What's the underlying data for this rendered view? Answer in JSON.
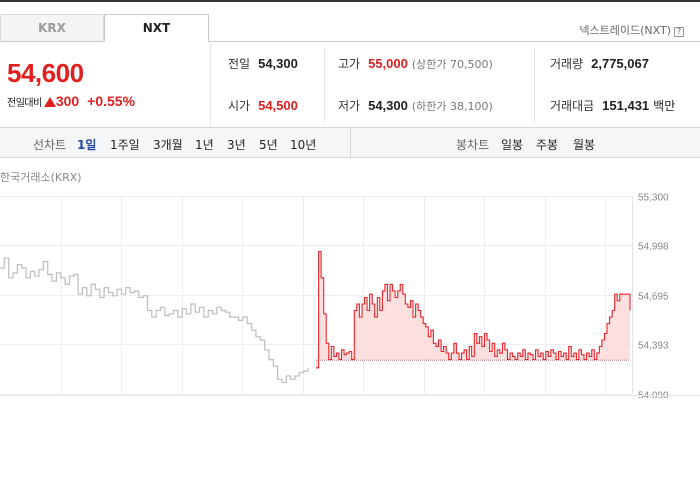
{
  "tabs": [
    {
      "label": "KRX",
      "active": false
    },
    {
      "label": "NXT",
      "active": true
    }
  ],
  "provider": {
    "label": "넥스트레이드(NXT)",
    "help_icon": "?"
  },
  "quote": {
    "price": "54,600",
    "change_label": "전일대비",
    "direction_icon": "up-triangle-icon",
    "change_value": "300",
    "change_percent": "+0.55%"
  },
  "stats": {
    "prev_close": {
      "label": "전일",
      "value": "54,300"
    },
    "high": {
      "label": "고가",
      "value": "55,000",
      "sub": "(상한가 70,500)"
    },
    "volume": {
      "label": "거래량",
      "value": "2,775,067"
    },
    "open": {
      "label": "시가",
      "value": "54,500"
    },
    "low": {
      "label": "저가",
      "value": "54,300",
      "sub": "(하한가 38,100)"
    },
    "turnover": {
      "label": "거래대금",
      "value": "151,431",
      "unit": "백만"
    }
  },
  "toolbar": {
    "line_label": "선차트",
    "line_periods": [
      "1일",
      "1주일",
      "3개월",
      "1년",
      "3년",
      "5년",
      "10년"
    ],
    "active_period": "1일",
    "candle_label": "봉차트",
    "candle_periods": [
      "일봉",
      "주봉",
      "월봉"
    ]
  },
  "chart_data": {
    "type": "line",
    "title": "한국거래소(KRX)",
    "y_ticks": [
      "55,300",
      "54,998",
      "54,695",
      "54,393",
      "54,090"
    ],
    "ylim": [
      54090,
      55300
    ],
    "baseline": 54300,
    "colors": {
      "krx": "#bdbdbd",
      "nxt": "#e8242a",
      "nxt_fill": "#fbd9d9",
      "grid": "#eeeeee"
    },
    "series": [
      {
        "values": [
          54860,
          54920,
          54800,
          54830,
          54880,
          54860,
          54800,
          54840,
          54810,
          54850,
          54900,
          54820,
          54780,
          54830,
          54800,
          54760,
          54810,
          54820,
          54700,
          54740,
          54690,
          54760,
          54730,
          54680,
          54740,
          54710,
          54690,
          54730,
          54700,
          54740,
          54710,
          54720,
          54680,
          54690,
          54600,
          54560,
          54600,
          54620,
          54570,
          54580,
          54600,
          54560,
          54610,
          54580,
          54640,
          54590,
          54620,
          54560,
          54600,
          54580,
          54620,
          54600,
          54590,
          54560,
          54560,
          54540,
          54560,
          54520,
          54480,
          54440,
          54420,
          54360,
          54300,
          54260,
          54180,
          54160,
          54200,
          54180,
          54200,
          54220,
          54230,
          54250
        ]
      },
      {
        "values": [
          54250,
          54960,
          54800,
          54580,
          54400,
          54300,
          54380,
          54320,
          54340,
          54300,
          54360,
          54330,
          54340,
          54350,
          54300,
          54600,
          54640,
          54560,
          54640,
          54680,
          54600,
          54700,
          54640,
          54560,
          54680,
          54600,
          54720,
          54760,
          54660,
          54760,
          54720,
          54680,
          54720,
          54760,
          54700,
          54640,
          54620,
          54660,
          54560,
          54640,
          54600,
          54560,
          54520,
          54500,
          54440,
          54480,
          54400,
          54380,
          54420,
          54350,
          54380,
          54340,
          54300,
          54340,
          54400,
          54340,
          54300,
          54340,
          54360,
          54300,
          54380,
          54320,
          54460,
          54400,
          54440,
          54380,
          54460,
          54420,
          54350,
          54400,
          54320,
          54360,
          54340,
          54400,
          54360,
          54300,
          54340,
          54320,
          54300,
          54340,
          54320,
          54360,
          54300,
          54340,
          54330,
          54300,
          54360,
          54320,
          54340,
          54300,
          54350,
          54320,
          54360,
          54340,
          54300,
          54350,
          54320,
          54340,
          54300,
          54380,
          54320,
          54340,
          54300,
          54360,
          54330,
          54300,
          54340,
          54320,
          54360,
          54300,
          54340,
          54380,
          54420,
          54460,
          54520,
          54560,
          54600,
          54700,
          54660,
          54700,
          54700,
          54700,
          54700,
          54600
        ]
      }
    ]
  }
}
